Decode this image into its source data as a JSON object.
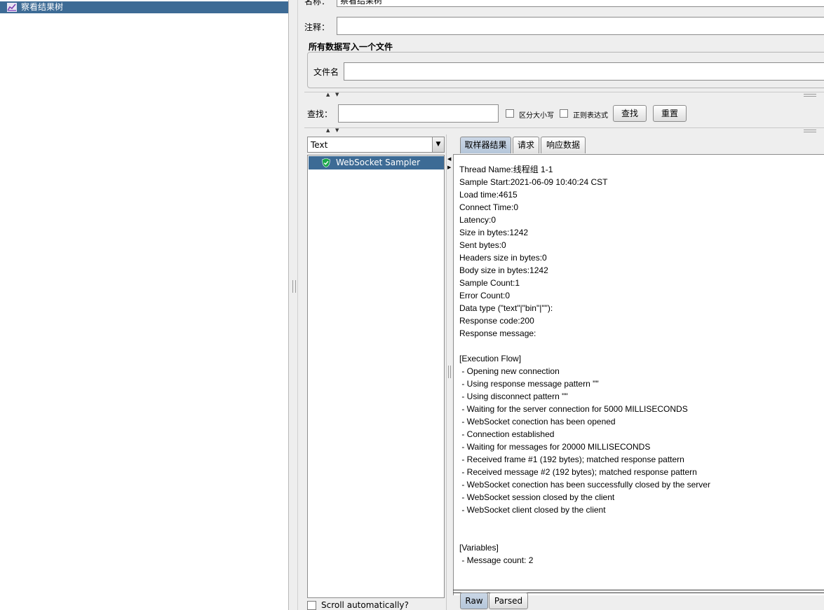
{
  "tree": {
    "node_label": "察看结果树"
  },
  "form": {
    "name_label": "名称：",
    "name_value": "察看结果树",
    "comment_label": "注释：",
    "file_group_title": "所有数据写入一个文件",
    "file_label": "文件名"
  },
  "search": {
    "label": "查找：",
    "case_label": "区分大小写",
    "regex_label": "正则表达式",
    "find_button": "查找",
    "reset_button": "重置"
  },
  "renderer": {
    "selected": "Text"
  },
  "results": {
    "items": [
      {
        "label": "WebSocket Sampler",
        "status": "success"
      }
    ],
    "scroll_label": "Scroll automatically?"
  },
  "tabs": [
    {
      "label": "取样器结果",
      "active": true
    },
    {
      "label": "请求",
      "active": false
    },
    {
      "label": "响应数据",
      "active": false
    }
  ],
  "sampler_result": [
    "Thread Name:线程组 1-1",
    "Sample Start:2021-06-09 10:40:24 CST",
    "Load time:4615",
    "Connect Time:0",
    "Latency:0",
    "Size in bytes:1242",
    "Sent bytes:0",
    "Headers size in bytes:0",
    "Body size in bytes:1242",
    "Sample Count:1",
    "Error Count:0",
    "Data type (\"text\"|\"bin\"|\"\"):",
    "Response code:200",
    "Response message:",
    "",
    "[Execution Flow]",
    " - Opening new connection",
    " - Using response message pattern \"\"",
    " - Using disconnect pattern \"\"",
    " - Waiting for the server connection for 5000 MILLISECONDS",
    " - WebSocket conection has been opened",
    " - Connection established",
    " - Waiting for messages for 20000 MILLISECONDS",
    " - Received frame #1 (192 bytes); matched response pattern",
    " - Received message #2 (192 bytes); matched response pattern",
    " - WebSocket conection has been successfully closed by the server",
    " - WebSocket session closed by the client",
    " - WebSocket client closed by the client",
    "",
    "",
    "[Variables]",
    " - Message count: 2"
  ],
  "bottom_tabs": {
    "raw": "Raw",
    "parsed": "Parsed"
  },
  "colors": {
    "selection": "#3d6b95",
    "panel_bg": "#eeeeee",
    "success": "#1aa84a"
  }
}
